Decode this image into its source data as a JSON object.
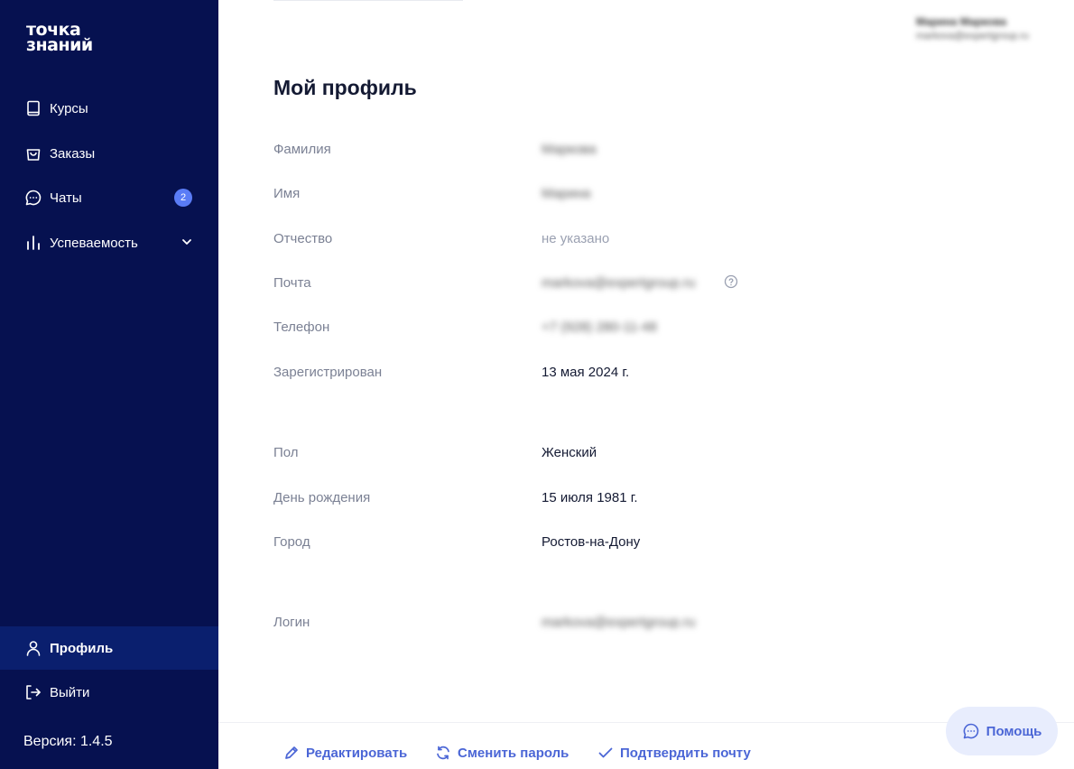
{
  "logo": {
    "line1": "точка",
    "line2": "знаний"
  },
  "sidebar": {
    "items": [
      {
        "label": "Курсы",
        "icon": "book-icon"
      },
      {
        "label": "Заказы",
        "icon": "bag-icon"
      },
      {
        "label": "Чаты",
        "icon": "chat-icon",
        "badge": "2"
      },
      {
        "label": "Успеваемость",
        "icon": "bar-chart-icon"
      }
    ],
    "profile": {
      "label": "Профиль",
      "icon": "user-icon"
    },
    "logout": {
      "label": "Выйти",
      "icon": "logout-icon"
    },
    "version": "Версия: 1.4.5"
  },
  "header": {
    "user_name": "Марина Маркова",
    "user_email": "markova@expertgroup.ru"
  },
  "main": {
    "title": "Мой профиль",
    "fields": [
      {
        "label": "Фамилия",
        "value": "Маркова"
      },
      {
        "label": "Имя",
        "value": "Марина"
      },
      {
        "label": "Отчество",
        "value": "не указано"
      },
      {
        "label": "Почта",
        "value": "markova@expertgroup.ru"
      },
      {
        "label": "Телефон",
        "value": "+7 (928) 280-11-48"
      },
      {
        "label": "Зарегистрирован",
        "value": "13 мая 2024 г."
      },
      {
        "label": "Пол",
        "value": "Женский"
      },
      {
        "label": "День рождения",
        "value": "15 июля 1981 г."
      },
      {
        "label": "Город",
        "value": "Ростов-на-Дону"
      },
      {
        "label": "Логин",
        "value": "markova@expertgroup.ru"
      }
    ]
  },
  "footer": {
    "edit": "Редактировать",
    "change_password": "Сменить пароль",
    "confirm_email": "Подтвердить почту"
  },
  "help_button": "Помощь",
  "colors": {
    "sidebar_bg": "#061150",
    "active_bg": "#0a1f6e",
    "accent": "#4b66d6",
    "badge": "#5a7cf6",
    "logo_dot": "#ff5a3c"
  }
}
